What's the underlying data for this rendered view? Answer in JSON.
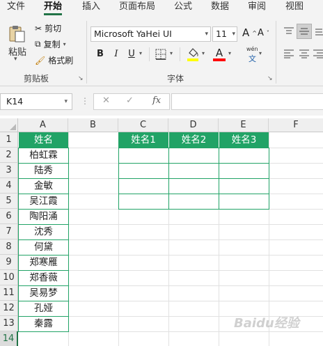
{
  "ribbon_tabs": [
    "文件",
    "开始",
    "插入",
    "页面布局",
    "公式",
    "数据",
    "审阅",
    "视图"
  ],
  "clipboard": {
    "paste_label": "粘贴",
    "cut_label": "剪切",
    "copy_label": "复制",
    "format_painter_label": "格式刷",
    "group_label": "剪贴板"
  },
  "font": {
    "name": "Microsoft YaHei UI",
    "size": "11",
    "grow": "A",
    "shrink": "A",
    "bold": "B",
    "italic": "I",
    "underline": "U",
    "font_color_letter": "A",
    "phonetic_top": "wén",
    "phonetic_bottom": "文",
    "group_label": "字体",
    "highlight_color": "#ffff00",
    "font_color": "#ff0000"
  },
  "formula_bar": {
    "name_box": "K14",
    "cancel": "✕",
    "enter": "✓",
    "fx": "fx",
    "value": ""
  },
  "sheet": {
    "columns": [
      "A",
      "B",
      "C",
      "D",
      "E",
      "F"
    ],
    "rows": [
      "1",
      "2",
      "3",
      "4",
      "5",
      "6",
      "7",
      "8",
      "9",
      "10",
      "11",
      "12",
      "13",
      "14"
    ],
    "col_a_header": "姓名",
    "names": [
      "柏虹霖",
      "陆秀",
      "金敏",
      "吴江霞",
      "陶阳涌",
      "沈秀",
      "何黛",
      "郑寒雁",
      "郑香薇",
      "吴易梦",
      "孔娅",
      "秦露"
    ],
    "target_headers": [
      "姓名1",
      "姓名2",
      "姓名3"
    ],
    "accent_color": "#21a366"
  },
  "watermark": "Baidu经验"
}
